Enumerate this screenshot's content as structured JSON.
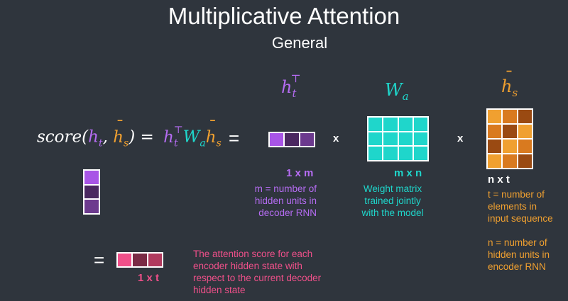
{
  "title": "Multiplicative Attention",
  "subtitle": "General",
  "labels": {
    "ht": "h",
    "ht_sub": "t",
    "ht_sup": "⊤",
    "wa": "W",
    "wa_sub": "a",
    "hs": "h",
    "hs_bar": "¯",
    "hs_sub": "s"
  },
  "formula": {
    "score": "score(",
    "h": "h",
    "t": "t",
    "comma": ", ",
    "s": "s",
    "close_eq": ") = ",
    "top": "⊤",
    "W": "W",
    "a": "a",
    "equals": "="
  },
  "operators": {
    "times_1": "x",
    "times_2": "x",
    "equals_result": "="
  },
  "matrices": {
    "ht": {
      "dim": "1 x m",
      "desc": [
        "m = number of",
        "hidden units in",
        "decoder RNN"
      ]
    },
    "wa": {
      "dim": "m x n",
      "desc": [
        "Weight matrix",
        "trained jointly",
        "with the model"
      ]
    },
    "hs": {
      "dim": "n x t",
      "desc": [
        "t = number of",
        "elements in",
        "input sequence",
        "",
        "n = number of",
        "hidden units in",
        "encoder RNN"
      ]
    },
    "result": {
      "dim": "1 x t",
      "desc": [
        "The attention score for each",
        "encoder hidden state with",
        "respect to the current decoder",
        "hidden state"
      ]
    }
  },
  "colors": {
    "background": "#2f353d",
    "purple": "#b56cf2",
    "teal": "#1fd6cb",
    "orange": "#f0a030",
    "pink": "#f0508a"
  }
}
